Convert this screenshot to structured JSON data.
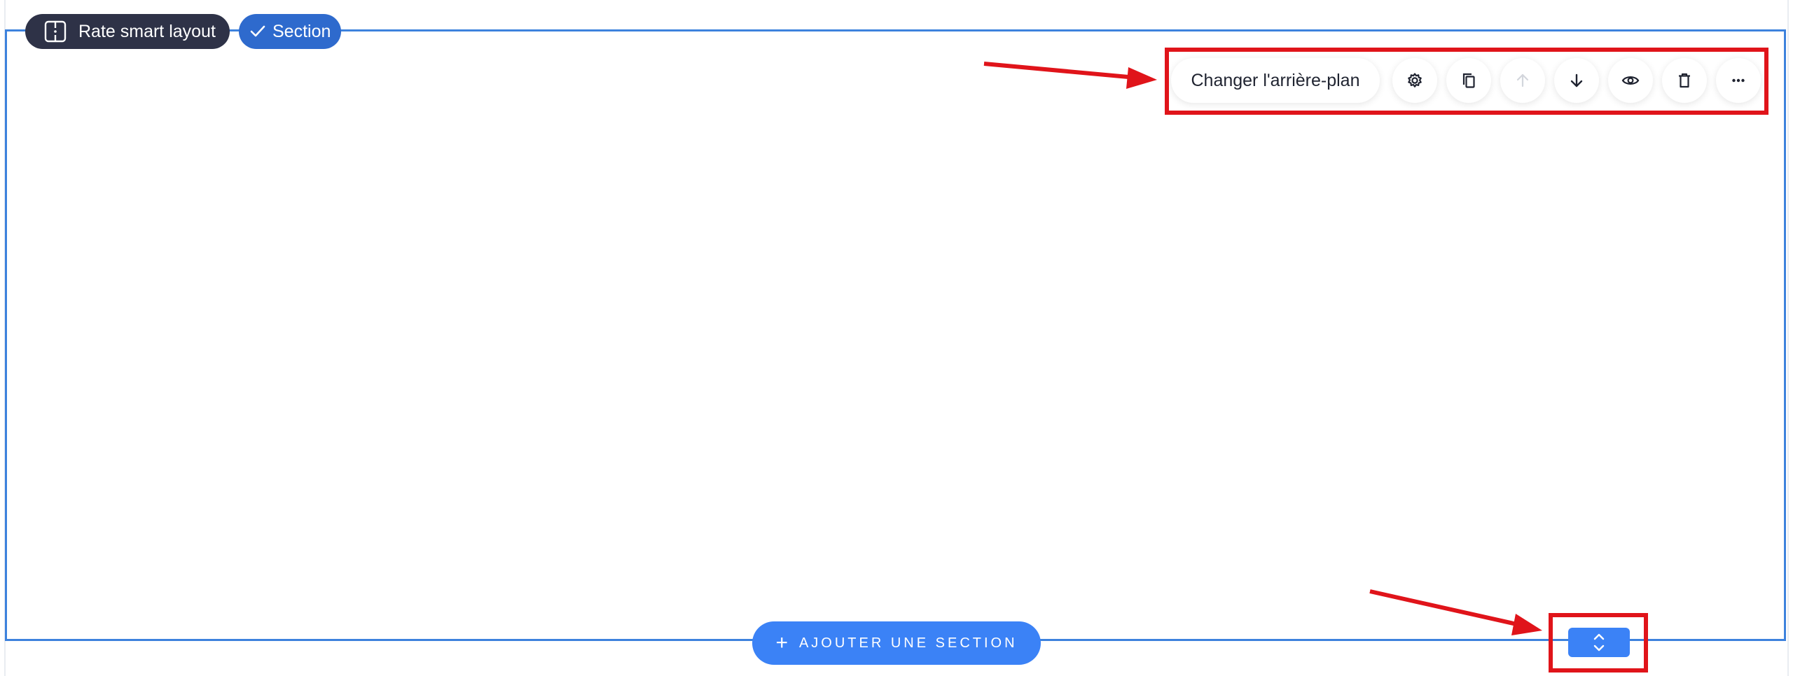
{
  "topbar": {
    "rate_label": "Rate smart layout",
    "rate_icon": "rate-layout-icon",
    "section_label": "Section",
    "section_icon": "checkmark-icon"
  },
  "section_toolbar": {
    "change_background_label": "Changer l'arrière-plan",
    "buttons": [
      {
        "name": "settings",
        "icon": "gear-icon",
        "enabled": true
      },
      {
        "name": "duplicate",
        "icon": "copy-icon",
        "enabled": true
      },
      {
        "name": "move-up",
        "icon": "arrow-up-icon",
        "enabled": false
      },
      {
        "name": "move-down",
        "icon": "arrow-down-icon",
        "enabled": true
      },
      {
        "name": "visibility",
        "icon": "eye-icon",
        "enabled": true
      },
      {
        "name": "delete",
        "icon": "trash-icon",
        "enabled": true
      },
      {
        "name": "more",
        "icon": "more-horizontal-icon",
        "enabled": true
      }
    ]
  },
  "add_section": {
    "icon": "plus-icon",
    "label": "AJOUTER UNE SECTION"
  },
  "resize_handle": {
    "icon": "chevron-up-down-icon"
  },
  "annotations": {
    "highlight_color": "#e0141a"
  },
  "colors": {
    "section_border": "#3d82dd",
    "primary": "#3b82f6",
    "dark_pill": "#2e3247",
    "section_pill": "#2e6acd"
  }
}
